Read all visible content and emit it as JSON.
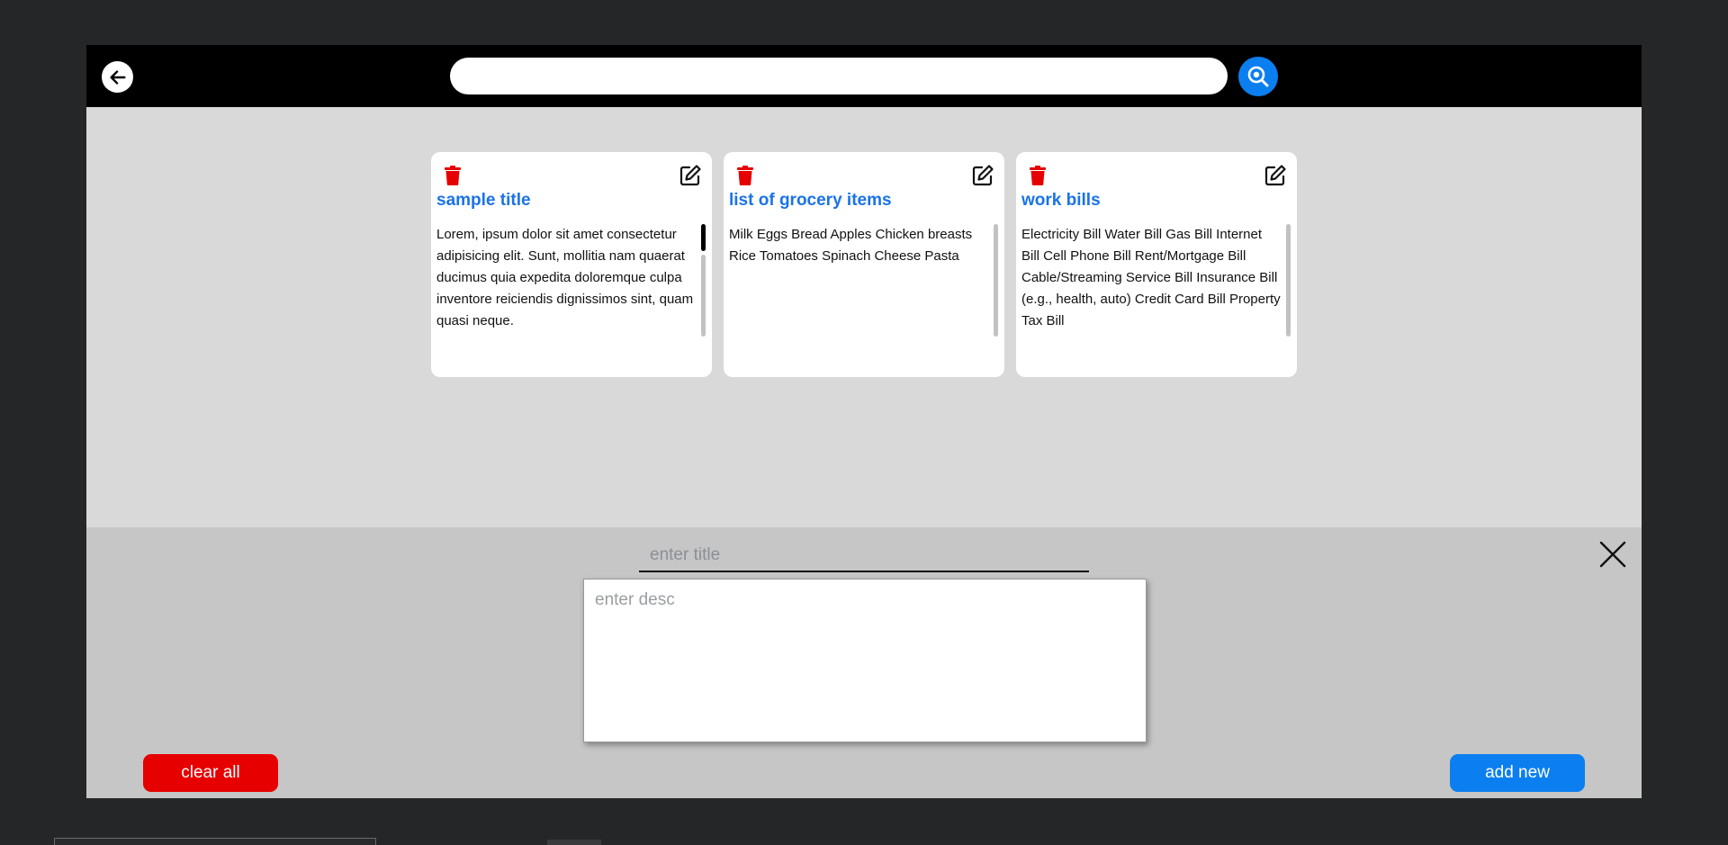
{
  "search": {
    "value": "",
    "placeholder": ""
  },
  "notes": [
    {
      "title": "sample title",
      "desc": "Lorem, ipsum dolor sit amet consectetur adipisicing elit. Sunt, mollitia nam quaerat ducimus quia expedita doloremque culpa inventore reiciendis dignissimos sint, quam quasi neque."
    },
    {
      "title": "list of grocery items",
      "desc": "Milk Eggs Bread Apples Chicken breasts Rice Tomatoes Spinach Cheese Pasta"
    },
    {
      "title": "work bills",
      "desc": "Electricity Bill Water Bill Gas Bill Internet Bill Cell Phone Bill Rent/Mortgage Bill Cable/Streaming Service Bill Insurance Bill (e.g., health, auto) Credit Card Bill Property Tax Bill"
    }
  ],
  "editor": {
    "title_placeholder": "enter title",
    "desc_placeholder": "enter desc",
    "clear_label": "clear all",
    "add_label": "add new"
  },
  "icons": {
    "back": "arrow-left-icon",
    "search": "search-icon",
    "delete": "trash-icon",
    "edit": "edit-icon",
    "close": "close-icon"
  },
  "colors": {
    "accent": "#0b7ff0",
    "danger": "#e60000",
    "title": "#1a73e8"
  }
}
